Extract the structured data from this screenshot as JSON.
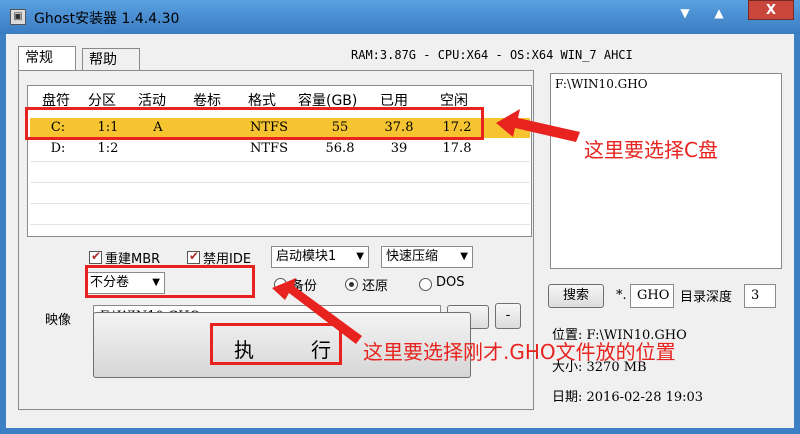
{
  "window": {
    "title": "Ghost安装器 1.4.4.30",
    "min_label": "▼",
    "max_label": "▲",
    "close_label": "X"
  },
  "tabs": [
    {
      "label": "常规",
      "active": true
    },
    {
      "label": "帮助",
      "active": false
    }
  ],
  "system_info": "RAM:3.87G - CPU:X64 - OS:X64 WIN_7 AHCI",
  "partition_table": {
    "headers": [
      "盘符",
      "分区",
      "活动",
      "卷标",
      "格式",
      "容量(GB)",
      "已用",
      "空闲"
    ],
    "rows": [
      {
        "drive": "C:",
        "partition": "1:1",
        "active": "A",
        "label": "",
        "format": "NTFS",
        "capacity": "55",
        "used": "37.8",
        "free": "17.2",
        "selected": true
      },
      {
        "drive": "D:",
        "partition": "1:2",
        "active": "",
        "label": "",
        "format": "NTFS",
        "capacity": "56.8",
        "used": "39",
        "free": "17.8",
        "selected": false
      }
    ]
  },
  "options": {
    "rebuild_mbr": {
      "label": "重建MBR",
      "checked": true
    },
    "disable_ide": {
      "label": "禁用IDE",
      "checked": true
    },
    "boot_module": "启动模块1",
    "compression": "快速压缩",
    "split": "不分卷",
    "mode_backup": "备份",
    "mode_restore": "还原",
    "mode_dos": "DOS",
    "selected_mode": "restore"
  },
  "image": {
    "label": "映像",
    "path": "F:\\WIN10.GHO",
    "browse_label": "..",
    "minus_label": "-"
  },
  "execute": {
    "left": "执",
    "right": "行"
  },
  "right_panel": {
    "list_items": [
      "F:\\WIN10.GHO"
    ],
    "search_label": "搜索",
    "pattern_prefix": "*.",
    "pattern_value": "GHO",
    "depth_label": "目录深度",
    "depth_value": "3",
    "location": "位置: F:\\WIN10.GHO",
    "size": "大小: 3270 MB",
    "date": "日期: 2016-02-28  19:03"
  },
  "annotations": {
    "drive_tip": "这里要选择C盘",
    "image_tip": "这里要选择刚才.GHO文件放的位置"
  },
  "colors": {
    "highlight_row": "#f5c430",
    "annotation_red": "#e8231f",
    "titlebar_blue": "#3d7fc4"
  }
}
